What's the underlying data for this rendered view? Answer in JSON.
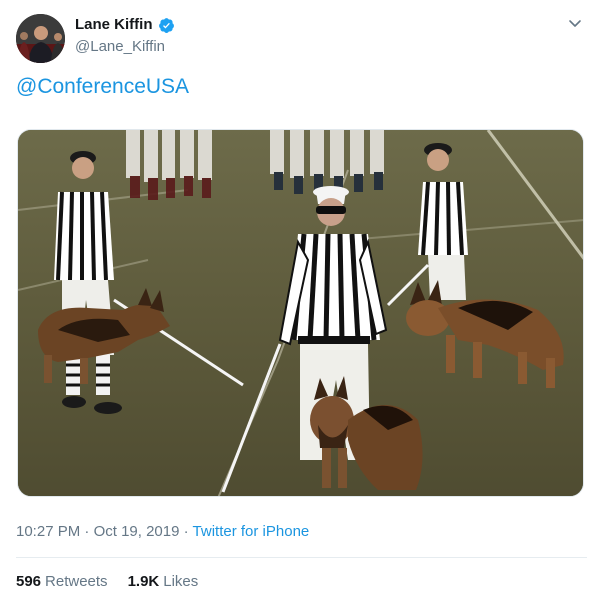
{
  "author": {
    "display_name": "Lane Kiffin",
    "handle": "@Lane_Kiffin",
    "verified": true
  },
  "tweet": {
    "text": "@ConferenceUSA",
    "media_description": "photo",
    "time": "10:27 PM",
    "date": "Oct 19, 2019",
    "separator": "·",
    "source": "Twitter for iPhone"
  },
  "stats": {
    "retweets_count": "596",
    "retweets_label": "Retweets",
    "likes_count": "1.9K",
    "likes_label": "Likes"
  },
  "colors": {
    "link": "#1b95e0",
    "secondary_text": "#657786",
    "primary_text": "#14171a",
    "verified_badge": "#1da1f2"
  },
  "icons": {
    "verified": "verified-badge-icon",
    "menu": "chevron-down-icon"
  }
}
